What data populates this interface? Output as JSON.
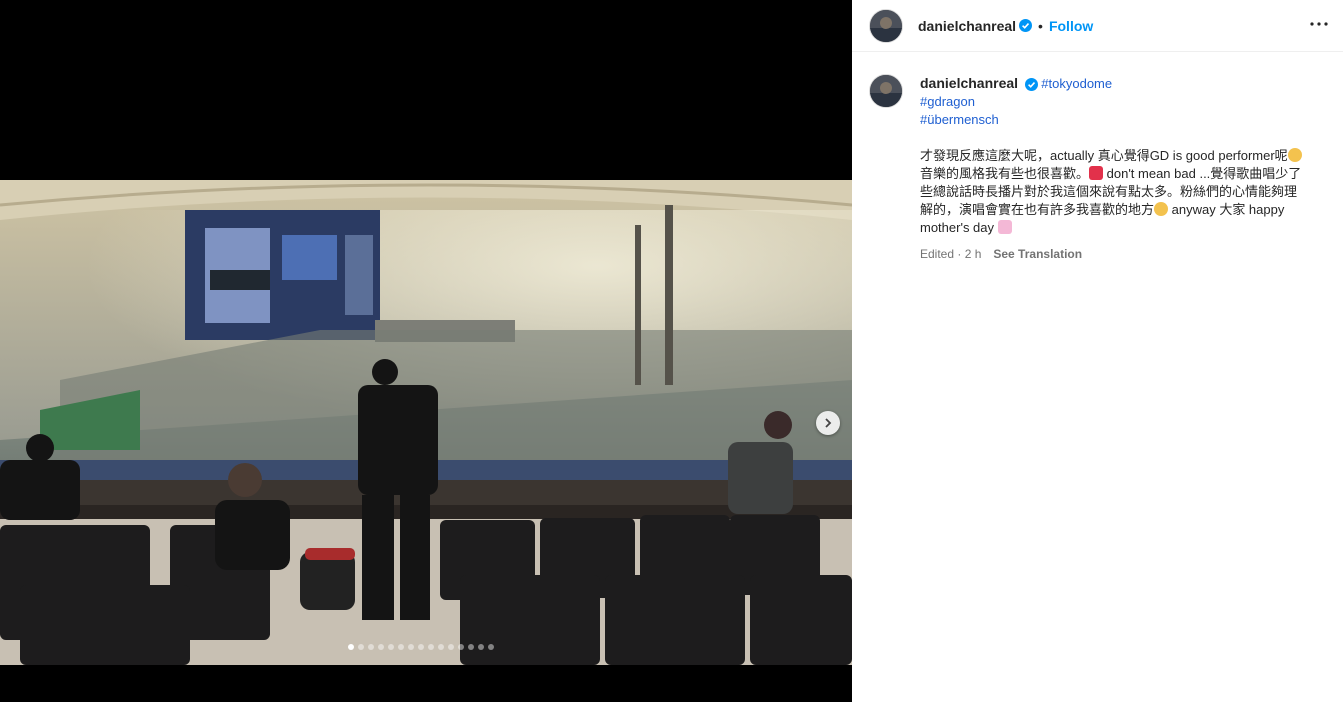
{
  "post": {
    "username": "danielchanreal",
    "follow_label": "Follow",
    "separator": "•",
    "caption_user": "danielchanreal",
    "tags": [
      "#tokyodome",
      "#gdragon",
      "#übermensch"
    ],
    "caption_line1": "才發現反應這麼大呢，actually 真心覺得GD is good performer呢",
    "caption_line2": "音樂的風格我有些也很喜歡。",
    "caption_line2b": " don't mean bad ...覺得歌曲唱少了",
    "caption_line3": "些總說話時長播片對於我這個來說有點太多。粉絲們的心情能夠理",
    "caption_line4": "解的，演唱會實在也有許多我喜歡的地方",
    "caption_line4b": " anyway 大家 happy",
    "caption_line5": "mother's day",
    "edited": "Edited · 2 h",
    "see_translation": "See Translation"
  },
  "carousel": {
    "total_slides": 15,
    "active_index": 0
  },
  "colors": {
    "follow": "#0095f6",
    "hashtag": "#1f5fd1",
    "verified": "#0095f6"
  },
  "icons": {
    "verified": "verified-badge-icon",
    "more": "more-options-icon",
    "next": "chevron-right-icon"
  }
}
